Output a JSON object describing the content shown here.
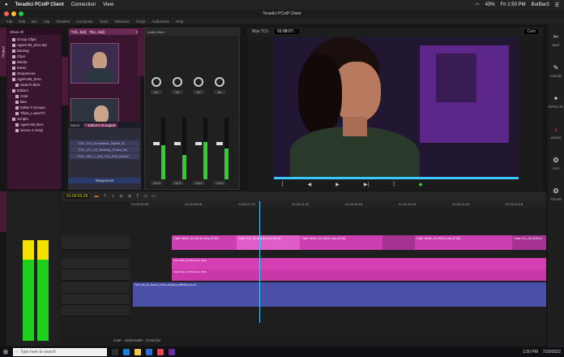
{
  "macbar": {
    "app": "Teradici PCoIP Client",
    "menus": [
      "Connection",
      "View"
    ],
    "battery": "43%",
    "clock": "Fri 1:50 PM",
    "user": "BurBar3"
  },
  "window": {
    "title": "Teradici PCoIP Client"
  },
  "appmenu": [
    "File",
    "Edit",
    "Bin",
    "Clip",
    "Timeline",
    "Composer",
    "Tools",
    "Windows",
    "Script",
    "AudioSuite",
    "Help"
  ],
  "bins": {
    "header": "Show All",
    "items": [
      "Group Clips",
      "Agent 98_Zero Bd",
      "Backup",
      "Clips",
      "Media",
      "Music",
      "Sequences",
      "Agent 98_Zero",
      "Search Bins",
      "Editors",
      "Cate",
      "Ben",
      "Editor's Groups",
      "Tikes_LowerTh",
      "Scripts",
      "Agent 98 Zero",
      "Scene 4 Scrip"
    ]
  },
  "thumbpanel": {
    "tabs": [
      "*Cli...led)",
      "*Do...led)"
    ]
  },
  "binlist": {
    "tabs": [
      "Music",
      "* Editor's Grouped"
    ],
    "clips": [
      "TCD_372_Unmasked_Stylish_B",
      "TCD_372_10_Seventy_Prices_Bu",
      "EVO_325_1_Into_The_Fire_Burnin"
    ],
    "seq_label": "Sequences"
  },
  "mixer": {
    "title": "Audio Mixer",
    "channels": [
      "A1",
      "A2",
      "A3",
      "A4"
    ],
    "levels": [
      0.55,
      0.4,
      0.6,
      0.5
    ],
    "db": [
      "-14.0",
      "-11.4",
      "-14.0",
      "-14.0"
    ]
  },
  "monitor": {
    "left_tc": "Mas TC1",
    "tc": "01:08:07:..",
    "right_menu": "Cam"
  },
  "rightbar": [
    "EDIT",
    "COLOR",
    "EFFECTS",
    "AUDIO",
    "FX3",
    "TITLES"
  ],
  "tltools": {
    "tc": "01:00:03;29"
  },
  "ruler": [
    "01:00:00:18",
    "01:00:08:18",
    "01:00:07:18",
    "01:00:11:18",
    "01:00:14:18",
    "01:00:18:18",
    "01:00:21:18",
    "01:00:24:18"
  ],
  "tracks": {
    "v1": [
      "Cate Wide_01.00:14.new (F02)",
      "Cate CU_01.001ia new (F02)",
      "Cate Wide_01.0014.new (F02)",
      "Cate Wide_01.0014.new (F02)",
      "Cate CU_01.0014.n"
    ],
    "a1": "Cate Wide_01.0014.new (F02)",
    "a2": "Cate Wide_01.0014.new (F02)",
    "a3": "TCD_372_24_Seventy_Prices_Burlapd_3582023.new.01"
  },
  "status": "Cate - 1920x1080 - 23.98 fps",
  "taskbar": {
    "search": "Type here to search",
    "clock": "1:50 PM",
    "date": "7/29/2022"
  }
}
